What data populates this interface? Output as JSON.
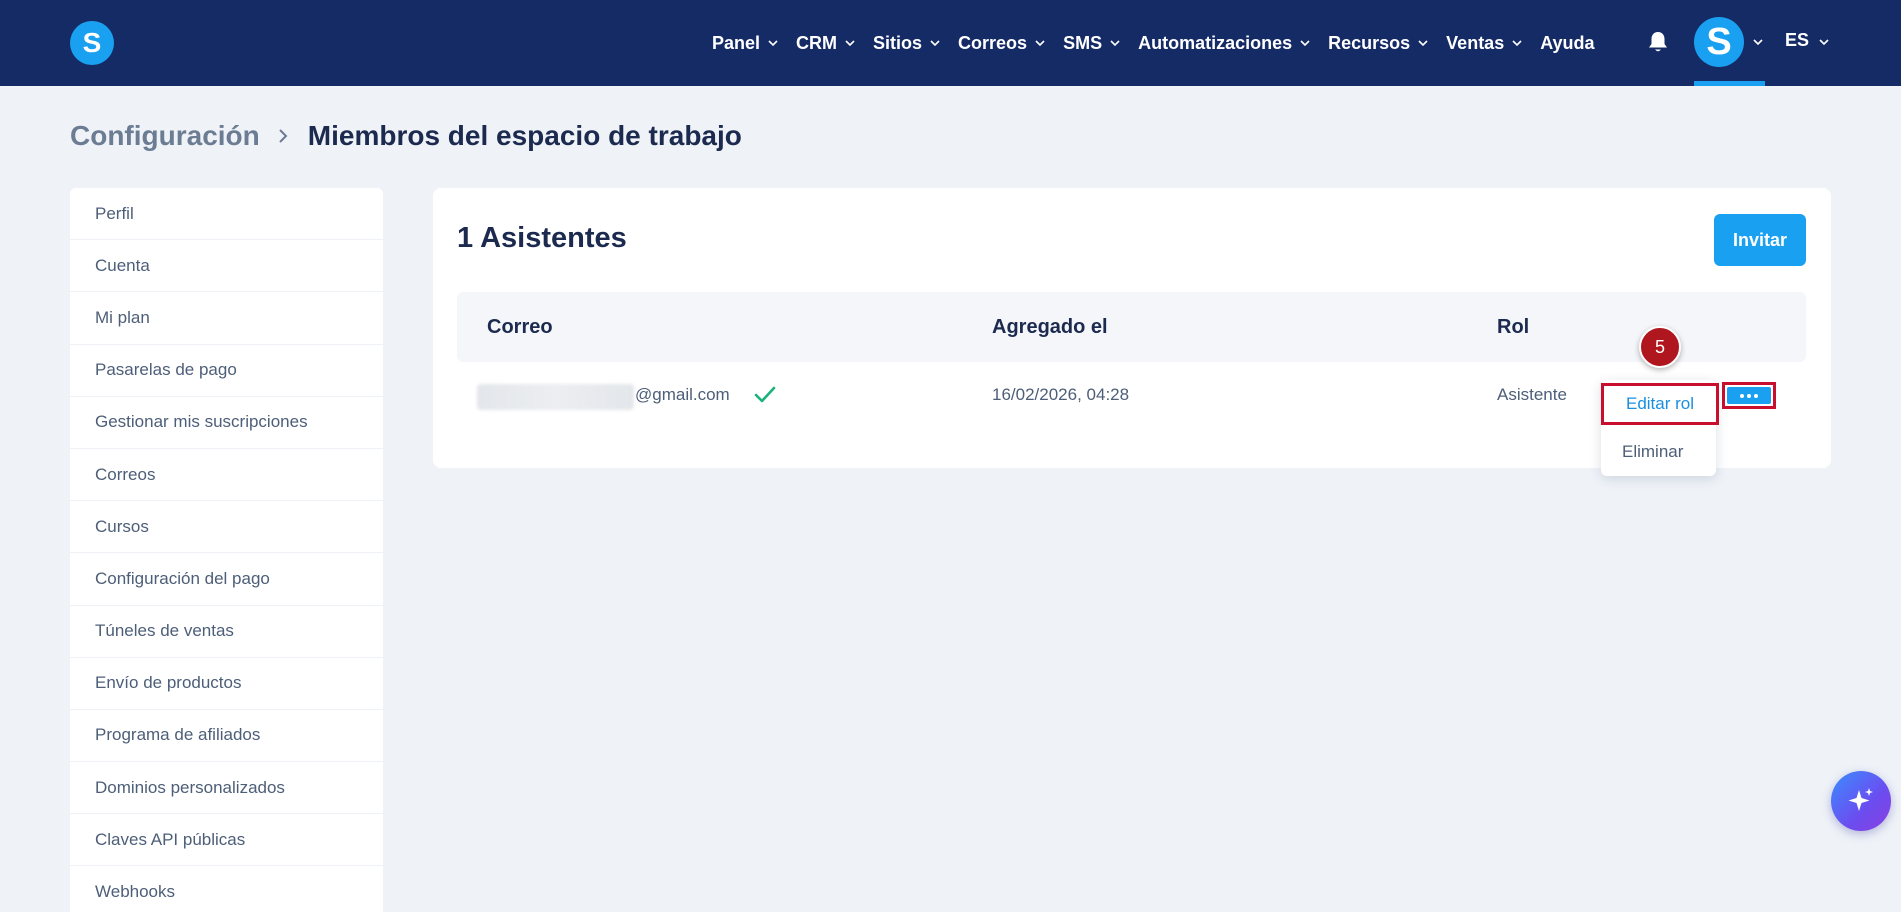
{
  "app": {
    "logo_letter": "S",
    "avatar_letter": "S",
    "language": "ES"
  },
  "nav": {
    "items": [
      "Panel",
      "CRM",
      "Sitios",
      "Correos",
      "SMS",
      "Automatizaciones",
      "Recursos",
      "Ventas",
      "Ayuda"
    ]
  },
  "breadcrumb": {
    "parent": "Configuración",
    "current": "Miembros del espacio de trabajo"
  },
  "sidebar": {
    "items": [
      "Perfil",
      "Cuenta",
      "Mi plan",
      "Pasarelas de pago",
      "Gestionar mis suscripciones",
      "Correos",
      "Cursos",
      "Configuración del pago",
      "Túneles de ventas",
      "Envío de productos",
      "Programa de afiliados",
      "Dominios personalizados",
      "Claves API públicas",
      "Webhooks"
    ]
  },
  "members": {
    "title": "1 Asistentes",
    "invite_label": "Invitar",
    "columns": {
      "email": "Correo",
      "added": "Agregado el",
      "role": "Rol"
    },
    "rows": [
      {
        "email_domain": "@gmail.com",
        "added": "16/02/2026, 04:28",
        "role": "Asistente"
      }
    ]
  },
  "menu": {
    "edit_role": "Editar rol",
    "delete": "Eliminar"
  },
  "annotation": {
    "step": "5"
  },
  "colors": {
    "nav_bg": "#152b66",
    "accent": "#1aa0f0",
    "highlight": "#c8102e",
    "badge": "#b0161e"
  }
}
